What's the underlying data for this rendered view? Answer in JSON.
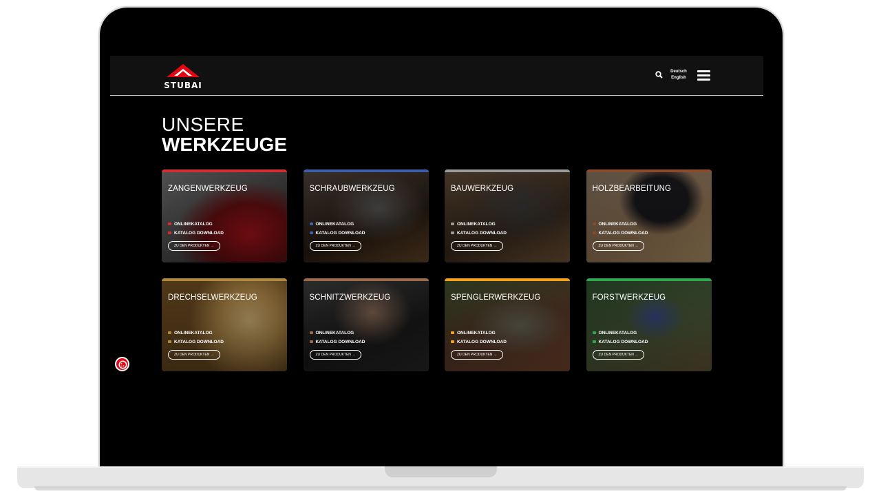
{
  "brand": {
    "name": "STUBAI",
    "accent": "#e30613"
  },
  "header": {
    "search_icon": "search-icon",
    "languages": [
      "Deutsch",
      "English"
    ],
    "menu_icon": "hamburger-menu-icon"
  },
  "page": {
    "title_line1": "UNSERE",
    "title_line2": "WERKZEUGE"
  },
  "cards": [
    {
      "title": "ZANGENWERKZEUG",
      "color": "#d22f35",
      "link1": "ONLINEKATALOG",
      "link2": "KATALOG DOWNLOAD",
      "button": "ZU DEN PRODUKTEN →"
    },
    {
      "title": "SCHRAUBWERKZEUG",
      "color": "#3e5fa8",
      "link1": "ONLINEKATALOG",
      "link2": "KATALOG DOWNLOAD",
      "button": "ZU DEN PRODUKTEN →"
    },
    {
      "title": "BAUWERKZEUG",
      "color": "#9a9a9a",
      "link1": "ONLINEKATALOG",
      "link2": "KATALOG DOWNLOAD",
      "button": "ZU DEN PRODUKTEN →"
    },
    {
      "title": "HOLZBEARBEITUNG",
      "color": "#8a4a2c",
      "link1": "ONLINEKATALOG",
      "link2": "KATALOG DOWNLOAD",
      "button": "ZU DEN PRODUKTEN →"
    },
    {
      "title": "DRECHSELWERKZEUG",
      "color": "#b08a3c",
      "link1": "ONLINEKATALOG",
      "link2": "KATALOG DOWNLOAD",
      "button": "ZU DEN PRODUKTEN →"
    },
    {
      "title": "SCHNITZWERKZEUG",
      "color": "#9a6a4a",
      "link1": "ONLINEKATALOG",
      "link2": "KATALOG DOWNLOAD",
      "button": "ZU DEN PRODUKTEN →"
    },
    {
      "title": "SPENGLERWERKZEUG",
      "color": "#f5a21a",
      "link1": "ONLINEKATALOG",
      "link2": "KATALOG DOWNLOAD",
      "button": "ZU DEN PRODUKTEN →"
    },
    {
      "title": "FORSTWERKZEUG",
      "color": "#2fa84f",
      "link1": "ONLINEKATALOG",
      "link2": "KATALOG DOWNLOAD",
      "button": "ZU DEN PRODUKTEN →"
    }
  ],
  "cookie_icon": "cookie-icon"
}
